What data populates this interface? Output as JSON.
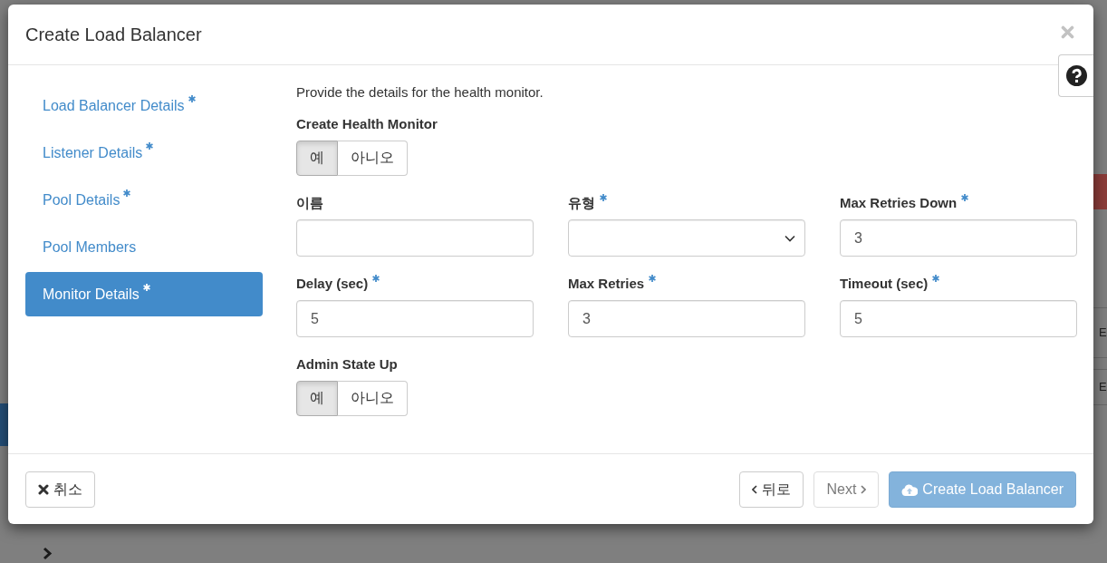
{
  "window": {
    "title": "Create Load Balancer"
  },
  "steps": [
    {
      "label": "Load Balancer Details",
      "required": true,
      "selected": false
    },
    {
      "label": "Listener Details",
      "required": true,
      "selected": false
    },
    {
      "label": "Pool Details",
      "required": true,
      "selected": false
    },
    {
      "label": "Pool Members",
      "required": false,
      "selected": false
    },
    {
      "label": "Monitor Details",
      "required": true,
      "selected": true
    }
  ],
  "form": {
    "intro": "Provide the details for the health monitor.",
    "fields": [
      {
        "kind": "toggle",
        "label": "Create Health Monitor",
        "required": false,
        "options": [
          {
            "label": "예",
            "selected": true
          },
          {
            "label": "아니오",
            "selected": false
          }
        ]
      },
      {
        "kind": "text",
        "label": "이름",
        "required": false
      },
      {
        "kind": "select",
        "label": "유형",
        "required": true
      },
      {
        "kind": "text",
        "label": "Max Retries Down",
        "required": true,
        "value": "3"
      },
      {
        "kind": "text",
        "label": "Delay (sec)",
        "required": true,
        "value": "5"
      },
      {
        "kind": "text",
        "label": "Max Retries",
        "required": true,
        "value": "3"
      },
      {
        "kind": "text",
        "label": "Timeout (sec)",
        "required": true,
        "value": "5"
      },
      {
        "kind": "toggle",
        "label": "Admin State Up",
        "required": false,
        "options": [
          {
            "label": "예",
            "selected": true
          },
          {
            "label": "아니오",
            "selected": false
          }
        ]
      }
    ]
  },
  "footer": {
    "buttons": [
      {
        "kind": "cancel",
        "label": "취소",
        "disabled": false
      },
      {
        "kind": "back",
        "label": "뒤로",
        "disabled": false
      },
      {
        "kind": "next",
        "label": "Next",
        "disabled": true
      },
      {
        "kind": "create",
        "label": "Create Load Balancer",
        "disabled": true
      }
    ]
  },
  "background_page": {
    "table_cells": [
      "E",
      "E"
    ]
  }
}
